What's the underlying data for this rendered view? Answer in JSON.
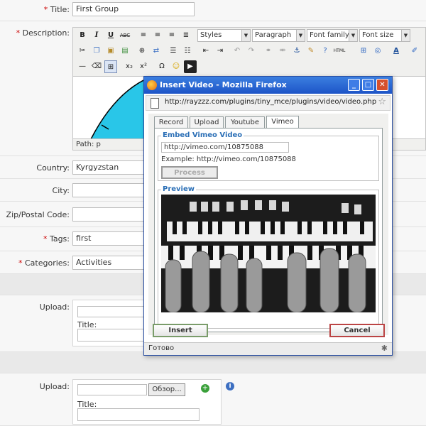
{
  "form": {
    "title_label": "Title:",
    "title_value": "First Group",
    "description_label": "Description:",
    "country_label": "Country:",
    "country_value": "Kyrgyzstan",
    "city_label": "City:",
    "zip_label": "Zip/Postal Code:",
    "tags_label": "Tags:",
    "tags_value": "first",
    "categories_label": "Categories:",
    "categories_value": "Activities",
    "upload_label": "Upload:",
    "upload_title_label": "Title:",
    "browse_label": "Обзор...",
    "required_mark": "*"
  },
  "editor": {
    "bold": "B",
    "italic": "I",
    "underline": "U",
    "strike": "ABC",
    "styles": "Styles",
    "format": "Paragraph",
    "font_family": "Font family",
    "font_size": "Font size",
    "html_label": "HTML",
    "subscript": "x₂",
    "superscript": "x²",
    "omega": "Ω",
    "path_text": "Path: p"
  },
  "popup": {
    "window_title": "Insert Video - Mozilla Firefox",
    "url": "http://rayzzz.com/plugins/tiny_mce/plugins/video/video.php",
    "tabs": [
      "Record",
      "Upload",
      "Youtube",
      "Vimeo"
    ],
    "active_tab": "Vimeo",
    "embed_legend": "Embed Vimeo Video",
    "embed_url": "http://vimeo.com/10875088",
    "example_text": "Example: http://vimeo.com/10875088",
    "process_label": "Process",
    "preview_legend": "Preview",
    "insert_label": "Insert",
    "cancel_label": "Cancel",
    "status_text": "Готово"
  }
}
